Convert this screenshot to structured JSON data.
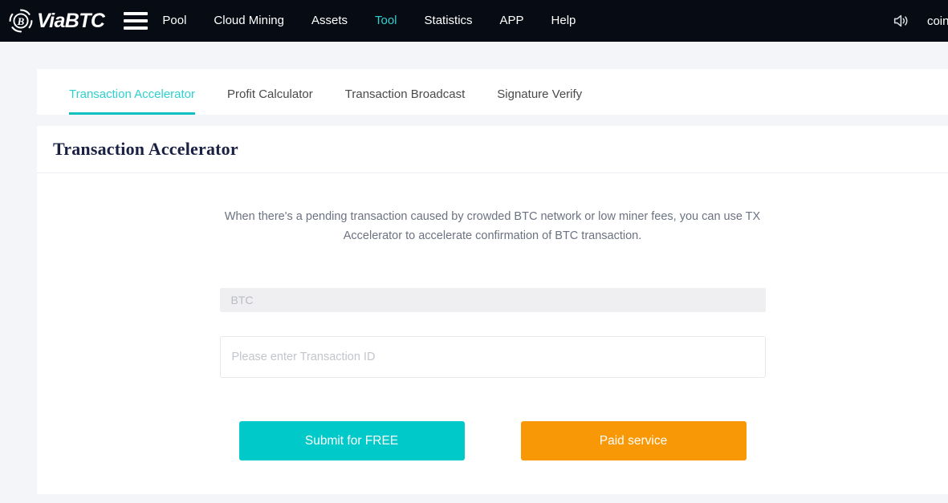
{
  "nav": {
    "brand_text": "ViaBTC",
    "brand_logo_name": "viabtc-bitcoin-logo",
    "menu_icon_name": "hamburger-menu-icon",
    "items": [
      {
        "label": "Pool",
        "active": false
      },
      {
        "label": "Cloud Mining",
        "active": false
      },
      {
        "label": "Assets",
        "active": false
      },
      {
        "label": "Tool",
        "active": true
      },
      {
        "label": "Statistics",
        "active": false
      },
      {
        "label": "APP",
        "active": false
      },
      {
        "label": "Help",
        "active": false
      }
    ],
    "announcement_icon_name": "speaker-announcement-icon",
    "user_name": "coinfu"
  },
  "tabs": [
    {
      "label": "Transaction Accelerator",
      "active": true
    },
    {
      "label": "Profit Calculator",
      "active": false
    },
    {
      "label": "Transaction Broadcast",
      "active": false
    },
    {
      "label": "Signature Verify",
      "active": false
    }
  ],
  "page": {
    "title": "Transaction Accelerator",
    "description": "When there's a pending transaction caused by crowded BTC network or low miner fees, you can use TX Accelerator to accelerate confirmation of BTC transaction."
  },
  "form": {
    "coin_value": "BTC",
    "txid_value": "",
    "txid_placeholder": "Please enter Transaction ID",
    "submit_free_label": "Submit for FREE",
    "paid_service_label": "Paid service"
  },
  "colors": {
    "nav_background": "#070b14",
    "accent_teal": "#2ed0cf",
    "button_teal": "#00c9c9",
    "button_orange": "#f99806",
    "page_background": "#f4f5f9",
    "title_navy": "#1a2042"
  }
}
